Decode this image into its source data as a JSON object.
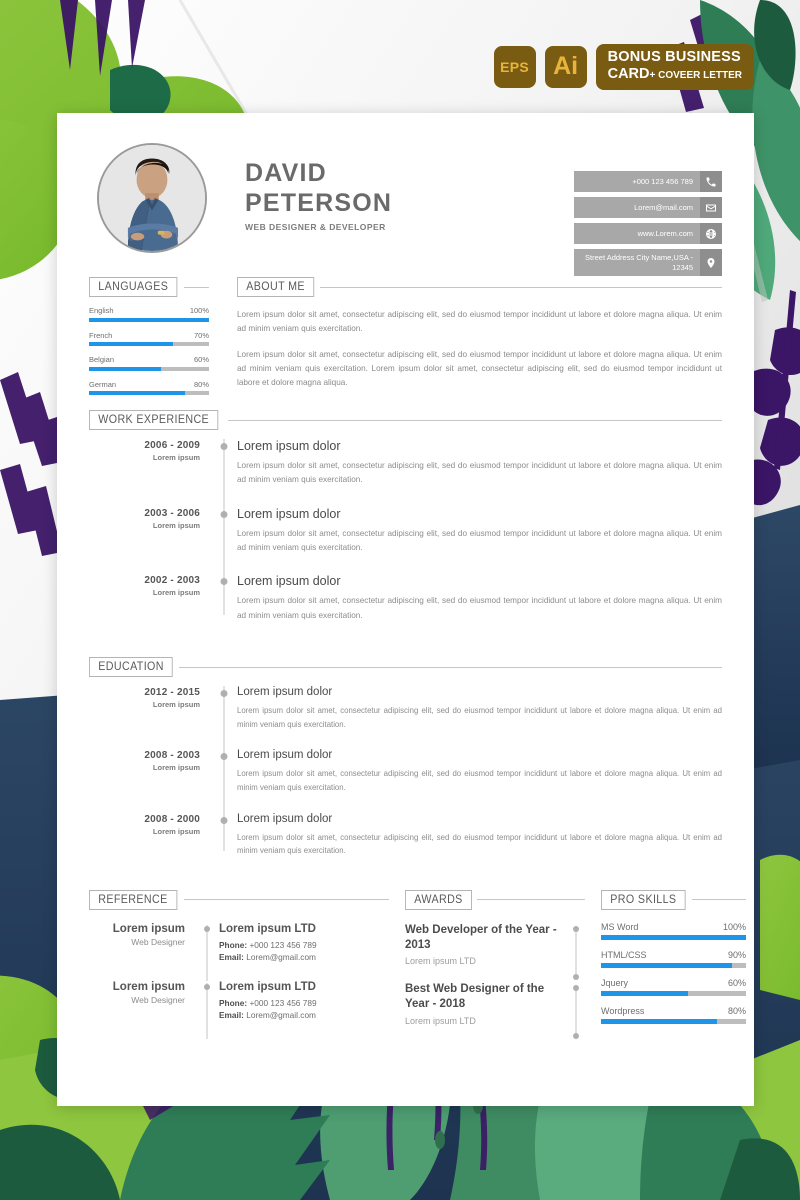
{
  "badges": {
    "eps": "EPS",
    "ai": "Ai",
    "bonus_line1": "BONUS BUSINESS",
    "bonus_line2": "CARD",
    "bonus_line2_small": "+ COVEER LETTER"
  },
  "header": {
    "first_name": "DAVID",
    "last_name": "PETERSON",
    "job_title": "WEB DESIGNER & DEVELOPER",
    "contacts": [
      {
        "text": "+000 123 456 789",
        "icon": "phone-icon"
      },
      {
        "text": "Lorem@mail.com",
        "icon": "envelope-icon"
      },
      {
        "text": "www.Lorem.com",
        "icon": "globe-icon"
      },
      {
        "text": "Street Address City Name,USA - 12345",
        "icon": "location-pin-icon"
      }
    ]
  },
  "languages": {
    "title": "LANGUAGES",
    "items": [
      {
        "name": "English",
        "value": "100%",
        "pct": 100
      },
      {
        "name": "French",
        "value": "70%",
        "pct": 70
      },
      {
        "name": "Belgian",
        "value": "60%",
        "pct": 60
      },
      {
        "name": "German",
        "value": "80%",
        "pct": 80
      }
    ]
  },
  "about": {
    "title": "ABOUT ME",
    "paragraph1": "Lorem ipsum dolor sit amet, consectetur adipiscing elit, sed do eiusmod tempor incididunt ut labore et dolore magna aliqua. Ut enim ad minim veniam quis exercitation.",
    "paragraph2": "Lorem ipsum dolor sit amet, consectetur adipiscing elit, sed do eiusmod tempor incididunt ut labore et dolore magna aliqua. Ut enim ad minim veniam quis exercitation. Lorem ipsum dolor sit amet, consectetur adipiscing elit, sed do eiusmod tempor incididunt ut labore et dolore magna aliqua."
  },
  "work": {
    "title": "WORK EXPERIENCE",
    "items": [
      {
        "date": "2006 - 2009",
        "subtitle": "Lorem ipsum",
        "title": "Lorem ipsum dolor",
        "desc": "Lorem ipsum dolor sit amet, consectetur adipiscing elit, sed do eiusmod tempor incididunt ut labore et dolore magna aliqua. Ut enim ad minim veniam quis exercitation."
      },
      {
        "date": "2003 - 2006",
        "subtitle": "Lorem ipsum",
        "title": "Lorem ipsum dolor",
        "desc": "Lorem ipsum dolor sit amet, consectetur adipiscing elit, sed do eiusmod tempor incididunt ut labore et dolore magna aliqua. Ut enim ad minim veniam quis exercitation."
      },
      {
        "date": "2002 - 2003",
        "subtitle": "Lorem ipsum",
        "title": "Lorem ipsum dolor",
        "desc": "Lorem ipsum dolor sit amet, consectetur adipiscing elit, sed do eiusmod tempor incididunt ut labore et dolore magna aliqua. Ut enim ad minim veniam quis exercitation."
      }
    ]
  },
  "education": {
    "title": "EDUCATION",
    "items": [
      {
        "date": "2012 - 2015",
        "subtitle": "Lorem ipsum",
        "title": "Lorem ipsum dolor",
        "desc": "Lorem ipsum dolor sit amet, consectetur adipiscing elit, sed do eiusmod tempor incididunt ut labore et dolore magna aliqua. Ut enim ad minim veniam quis exercitation."
      },
      {
        "date": "2008 - 2003",
        "subtitle": "Lorem ipsum",
        "title": "Lorem ipsum dolor",
        "desc": "Lorem ipsum dolor sit amet, consectetur adipiscing elit, sed do eiusmod tempor incididunt ut labore et dolore magna aliqua. Ut enim ad minim veniam quis exercitation."
      },
      {
        "date": "2008 - 2000",
        "subtitle": "Lorem ipsum",
        "title": "Lorem ipsum dolor",
        "desc": "Lorem ipsum dolor sit amet, consectetur adipiscing elit, sed do eiusmod tempor incididunt ut labore et dolore magna aliqua. Ut enim ad minim veniam quis exercitation."
      }
    ]
  },
  "reference": {
    "title": "REFERENCE",
    "items": [
      {
        "name": "Lorem ipsum",
        "role": "Web Designer",
        "company": "Lorem ipsum LTD",
        "phone_label": "Phone:",
        "phone": "+000 123 456 789",
        "email_label": "Email:",
        "email": "Lorem@gmail.com"
      },
      {
        "name": "Lorem ipsum",
        "role": "Web Designer",
        "company": "Lorem ipsum LTD",
        "phone_label": "Phone:",
        "phone": "+000 123 456 789",
        "email_label": "Email:",
        "email": "Lorem@gmail.com"
      }
    ]
  },
  "awards": {
    "title": "AWARDS",
    "items": [
      {
        "title": "Web Developer of the Year - 2013",
        "sub": "Lorem ipsum LTD"
      },
      {
        "title": "Best Web Designer of the Year - 2018",
        "sub": "Lorem ipsum LTD"
      }
    ]
  },
  "skills": {
    "title": "PRO SKILLS",
    "items": [
      {
        "name": "MS Word",
        "value": "100%",
        "pct": 100
      },
      {
        "name": "HTML/CSS",
        "value": "90%",
        "pct": 90
      },
      {
        "name": "Jquery",
        "value": "60%",
        "pct": 60
      },
      {
        "name": "Wordpress",
        "value": "80%",
        "pct": 80
      }
    ]
  },
  "colors": {
    "accent_blue": "#1e95e8",
    "bar_track": "#bdbdbd",
    "badge_brown": "#7a5b12",
    "badge_gold": "#e8b53a",
    "contact_gray": "#a8a8a8"
  }
}
